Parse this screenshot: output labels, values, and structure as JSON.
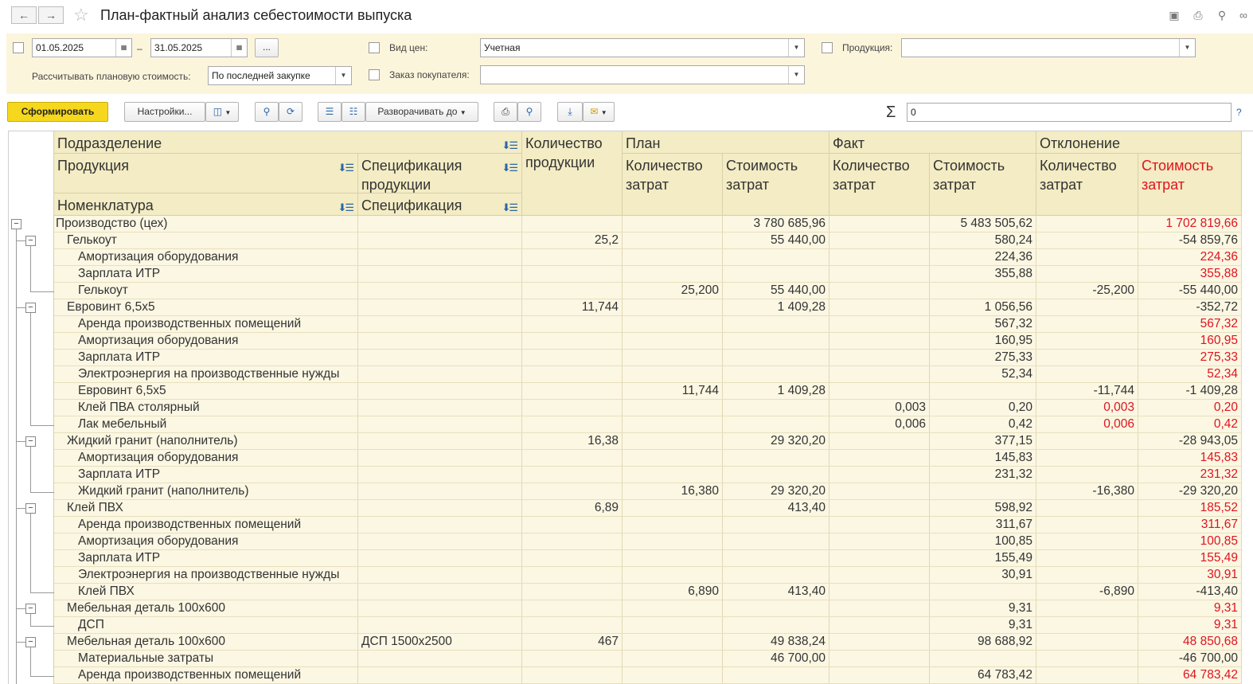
{
  "window": {
    "title": "План-фактный анализ себестоимости выпуска"
  },
  "filters": {
    "date_from": "01.05.2025",
    "date_dash": "–",
    "date_to": "31.05.2025",
    "period_button": "...",
    "price_type_label": "Вид цен:",
    "price_type_value": "Учетная",
    "product_label": "Продукция:",
    "product_value": "",
    "plan_cost_label": "Рассчитывать плановую стоимость:",
    "plan_cost_value": "По последней закупке",
    "order_label": "Заказ покупателя:",
    "order_value": ""
  },
  "toolbar": {
    "generate": "Сформировать",
    "settings": "Настройки...",
    "expand_to": "Разворачивать до",
    "sigma": "Σ",
    "sum_value": "0",
    "help": "?"
  },
  "header": {
    "department": "Подразделение",
    "product": "Продукция",
    "nomenclature": "Номенклатура",
    "spec_product": "Спецификация продукции",
    "spec": "Спецификация",
    "qty_product": "Количество продукции",
    "plan": "План",
    "fact": "Факт",
    "deviation": "Отклонение",
    "qty_costs": "Количество затрат",
    "cost_costs": "Стоимость затрат"
  },
  "rows": [
    {
      "level": 0,
      "name": "Производство (цех)",
      "spec": "",
      "qty": "",
      "plan_qty": "",
      "plan_cost": "3 780 685,96",
      "fact_qty": "",
      "fact_cost": "5 483 505,62",
      "dev_qty": "",
      "dev_cost": "1 702 819,66",
      "dev_qty_red": false,
      "dev_cost_red": true
    },
    {
      "level": 1,
      "name": "Гелькоут",
      "spec": "",
      "qty": "25,2",
      "plan_qty": "",
      "plan_cost": "55 440,00",
      "fact_qty": "",
      "fact_cost": "580,24",
      "dev_qty": "",
      "dev_cost": "-54 859,76",
      "dev_qty_red": false,
      "dev_cost_red": false
    },
    {
      "level": 2,
      "name": "Амортизация оборудования",
      "spec": "",
      "qty": "",
      "plan_qty": "",
      "plan_cost": "",
      "fact_qty": "",
      "fact_cost": "224,36",
      "dev_qty": "",
      "dev_cost": "224,36",
      "dev_qty_red": false,
      "dev_cost_red": true
    },
    {
      "level": 2,
      "name": "Зарплата ИТР",
      "spec": "",
      "qty": "",
      "plan_qty": "",
      "plan_cost": "",
      "fact_qty": "",
      "fact_cost": "355,88",
      "dev_qty": "",
      "dev_cost": "355,88",
      "dev_qty_red": false,
      "dev_cost_red": true
    },
    {
      "level": 2,
      "name": "Гелькоут",
      "spec": "",
      "qty": "",
      "plan_qty": "25,200",
      "plan_cost": "55 440,00",
      "fact_qty": "",
      "fact_cost": "",
      "dev_qty": "-25,200",
      "dev_cost": "-55 440,00",
      "dev_qty_red": false,
      "dev_cost_red": false
    },
    {
      "level": 1,
      "name": "Евровинт 6,5x5",
      "spec": "",
      "qty": "11,744",
      "plan_qty": "",
      "plan_cost": "1 409,28",
      "fact_qty": "",
      "fact_cost": "1 056,56",
      "dev_qty": "",
      "dev_cost": "-352,72",
      "dev_qty_red": false,
      "dev_cost_red": false
    },
    {
      "level": 2,
      "name": "Аренда производственных помещений",
      "spec": "",
      "qty": "",
      "plan_qty": "",
      "plan_cost": "",
      "fact_qty": "",
      "fact_cost": "567,32",
      "dev_qty": "",
      "dev_cost": "567,32",
      "dev_qty_red": false,
      "dev_cost_red": true
    },
    {
      "level": 2,
      "name": "Амортизация оборудования",
      "spec": "",
      "qty": "",
      "plan_qty": "",
      "plan_cost": "",
      "fact_qty": "",
      "fact_cost": "160,95",
      "dev_qty": "",
      "dev_cost": "160,95",
      "dev_qty_red": false,
      "dev_cost_red": true
    },
    {
      "level": 2,
      "name": "Зарплата ИТР",
      "spec": "",
      "qty": "",
      "plan_qty": "",
      "plan_cost": "",
      "fact_qty": "",
      "fact_cost": "275,33",
      "dev_qty": "",
      "dev_cost": "275,33",
      "dev_qty_red": false,
      "dev_cost_red": true
    },
    {
      "level": 2,
      "name": "Электроэнергия на производственные нужды",
      "spec": "",
      "qty": "",
      "plan_qty": "",
      "plan_cost": "",
      "fact_qty": "",
      "fact_cost": "52,34",
      "dev_qty": "",
      "dev_cost": "52,34",
      "dev_qty_red": false,
      "dev_cost_red": true
    },
    {
      "level": 2,
      "name": "Евровинт 6,5x5",
      "spec": "",
      "qty": "",
      "plan_qty": "11,744",
      "plan_cost": "1 409,28",
      "fact_qty": "",
      "fact_cost": "",
      "dev_qty": "-11,744",
      "dev_cost": "-1 409,28",
      "dev_qty_red": false,
      "dev_cost_red": false
    },
    {
      "level": 2,
      "name": "Клей ПВА столярный",
      "spec": "",
      "qty": "",
      "plan_qty": "",
      "plan_cost": "",
      "fact_qty": "0,003",
      "fact_cost": "0,20",
      "dev_qty": "0,003",
      "dev_cost": "0,20",
      "dev_qty_red": true,
      "dev_cost_red": true
    },
    {
      "level": 2,
      "name": "Лак мебельный",
      "spec": "",
      "qty": "",
      "plan_qty": "",
      "plan_cost": "",
      "fact_qty": "0,006",
      "fact_cost": "0,42",
      "dev_qty": "0,006",
      "dev_cost": "0,42",
      "dev_qty_red": true,
      "dev_cost_red": true
    },
    {
      "level": 1,
      "name": "Жидкий гранит (наполнитель)",
      "spec": "",
      "qty": "16,38",
      "plan_qty": "",
      "plan_cost": "29 320,20",
      "fact_qty": "",
      "fact_cost": "377,15",
      "dev_qty": "",
      "dev_cost": "-28 943,05",
      "dev_qty_red": false,
      "dev_cost_red": false
    },
    {
      "level": 2,
      "name": "Амортизация оборудования",
      "spec": "",
      "qty": "",
      "plan_qty": "",
      "plan_cost": "",
      "fact_qty": "",
      "fact_cost": "145,83",
      "dev_qty": "",
      "dev_cost": "145,83",
      "dev_qty_red": false,
      "dev_cost_red": true
    },
    {
      "level": 2,
      "name": "Зарплата ИТР",
      "spec": "",
      "qty": "",
      "plan_qty": "",
      "plan_cost": "",
      "fact_qty": "",
      "fact_cost": "231,32",
      "dev_qty": "",
      "dev_cost": "231,32",
      "dev_qty_red": false,
      "dev_cost_red": true
    },
    {
      "level": 2,
      "name": "Жидкий гранит (наполнитель)",
      "spec": "",
      "qty": "",
      "plan_qty": "16,380",
      "plan_cost": "29 320,20",
      "fact_qty": "",
      "fact_cost": "",
      "dev_qty": "-16,380",
      "dev_cost": "-29 320,20",
      "dev_qty_red": false,
      "dev_cost_red": false
    },
    {
      "level": 1,
      "name": "Клей ПВХ",
      "spec": "",
      "qty": "6,89",
      "plan_qty": "",
      "plan_cost": "413,40",
      "fact_qty": "",
      "fact_cost": "598,92",
      "dev_qty": "",
      "dev_cost": "185,52",
      "dev_qty_red": false,
      "dev_cost_red": true
    },
    {
      "level": 2,
      "name": "Аренда производственных помещений",
      "spec": "",
      "qty": "",
      "plan_qty": "",
      "plan_cost": "",
      "fact_qty": "",
      "fact_cost": "311,67",
      "dev_qty": "",
      "dev_cost": "311,67",
      "dev_qty_red": false,
      "dev_cost_red": true
    },
    {
      "level": 2,
      "name": "Амортизация оборудования",
      "spec": "",
      "qty": "",
      "plan_qty": "",
      "plan_cost": "",
      "fact_qty": "",
      "fact_cost": "100,85",
      "dev_qty": "",
      "dev_cost": "100,85",
      "dev_qty_red": false,
      "dev_cost_red": true
    },
    {
      "level": 2,
      "name": "Зарплата ИТР",
      "spec": "",
      "qty": "",
      "plan_qty": "",
      "plan_cost": "",
      "fact_qty": "",
      "fact_cost": "155,49",
      "dev_qty": "",
      "dev_cost": "155,49",
      "dev_qty_red": false,
      "dev_cost_red": true
    },
    {
      "level": 2,
      "name": "Электроэнергия на производственные нужды",
      "spec": "",
      "qty": "",
      "plan_qty": "",
      "plan_cost": "",
      "fact_qty": "",
      "fact_cost": "30,91",
      "dev_qty": "",
      "dev_cost": "30,91",
      "dev_qty_red": false,
      "dev_cost_red": true
    },
    {
      "level": 2,
      "name": "Клей ПВХ",
      "spec": "",
      "qty": "",
      "plan_qty": "6,890",
      "plan_cost": "413,40",
      "fact_qty": "",
      "fact_cost": "",
      "dev_qty": "-6,890",
      "dev_cost": "-413,40",
      "dev_qty_red": false,
      "dev_cost_red": false
    },
    {
      "level": 1,
      "name": "Мебельная деталь 100х600",
      "spec": "",
      "qty": "",
      "plan_qty": "",
      "plan_cost": "",
      "fact_qty": "",
      "fact_cost": "9,31",
      "dev_qty": "",
      "dev_cost": "9,31",
      "dev_qty_red": false,
      "dev_cost_red": true
    },
    {
      "level": 2,
      "name": "ДСП",
      "spec": "",
      "qty": "",
      "plan_qty": "",
      "plan_cost": "",
      "fact_qty": "",
      "fact_cost": "9,31",
      "dev_qty": "",
      "dev_cost": "9,31",
      "dev_qty_red": false,
      "dev_cost_red": true
    },
    {
      "level": 1,
      "name": "Мебельная деталь 100х600",
      "spec": "ДСП 1500х2500",
      "qty": "467",
      "plan_qty": "",
      "plan_cost": "49 838,24",
      "fact_qty": "",
      "fact_cost": "98 688,92",
      "dev_qty": "",
      "dev_cost": "48 850,68",
      "dev_qty_red": false,
      "dev_cost_red": true
    },
    {
      "level": 2,
      "name": "Материальные затраты",
      "spec": "",
      "qty": "",
      "plan_qty": "",
      "plan_cost": "46 700,00",
      "fact_qty": "",
      "fact_cost": "",
      "dev_qty": "",
      "dev_cost": "-46 700,00",
      "dev_qty_red": false,
      "dev_cost_red": false
    },
    {
      "level": 2,
      "name": "Аренда производственных помещений",
      "spec": "",
      "qty": "",
      "plan_qty": "",
      "plan_cost": "",
      "fact_qty": "",
      "fact_cost": "64 783,42",
      "dev_qty": "",
      "dev_cost": "64 783,42",
      "dev_qty_red": false,
      "dev_cost_red": true
    }
  ],
  "colors": {
    "accent_yellow": "#f5d71e",
    "header_bg": "#f3ecc4",
    "row_bg": "#fbf7e3",
    "negative_red": "#e0141e"
  }
}
